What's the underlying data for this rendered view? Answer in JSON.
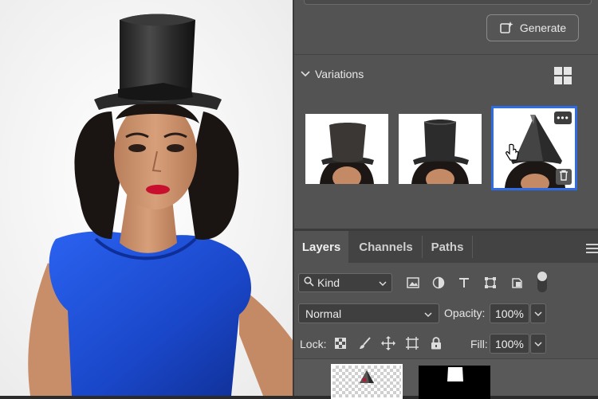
{
  "generate": {
    "label": "Generate",
    "icon": "generate-icon"
  },
  "variations": {
    "title": "Variations",
    "grid_icon": "grid-view-icon"
  },
  "thumbnails": [
    {
      "name": "variation-1"
    },
    {
      "name": "variation-2"
    },
    {
      "name": "variation-3",
      "selected": true,
      "more": "•••"
    }
  ],
  "layers_panel": {
    "tabs": [
      {
        "label": "Layers"
      },
      {
        "label": "Channels"
      },
      {
        "label": "Paths"
      }
    ],
    "filter": {
      "kind": "Kind"
    },
    "blend_mode": "Normal",
    "opacity_label": "Opacity:",
    "opacity_value": "100%",
    "lock_label": "Lock:",
    "fill_label": "Fill:",
    "fill_value": "100%"
  },
  "colors": {
    "panel_bg": "#535353",
    "selection_accent": "#2f6be3",
    "dress": "#1f4fd6",
    "lips": "#c8102e"
  }
}
